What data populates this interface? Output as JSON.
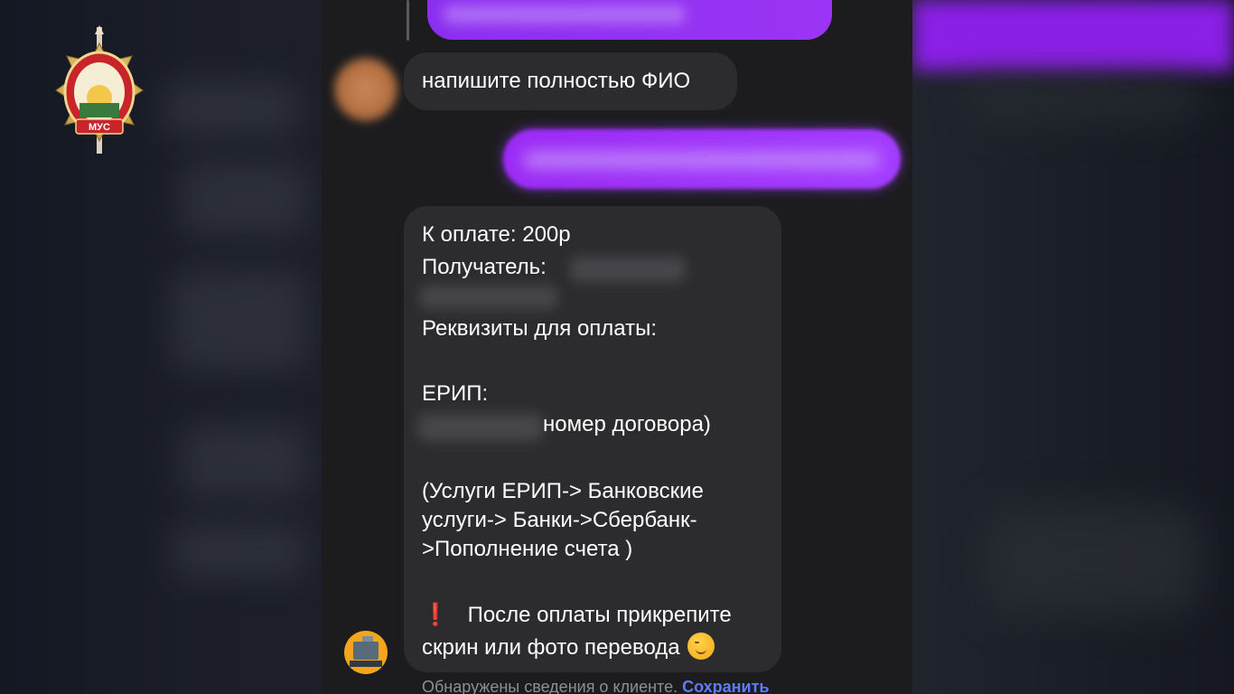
{
  "emblem": {
    "text": "МУС"
  },
  "chat": {
    "messages": [
      {
        "text": "напишите полностью ФИО"
      }
    ],
    "payment": {
      "amount_line": "К оплате: 200р",
      "recipient_label": "Получатель:",
      "requisites_label": "Реквизиты для оплаты:",
      "erip_label": "ЕРИП:",
      "contract_suffix": "номер договора)",
      "path_line1": "(Услуги ЕРИП-> Банковские",
      "path_line2": "услуги-> Банки->Сбербанк-",
      "path_line3": ">Пополнение счета )",
      "after_line1": "После оплаты прикрепите",
      "after_line2": "скрин или фото перевода",
      "exclamation": "❗",
      "emoji_name": "winking-face-emoji"
    },
    "client_note": {
      "text": "Обнаружены сведения о клиенте.",
      "action": "Сохранить"
    }
  },
  "colors": {
    "outgoing_bubble": "#9b2bf5",
    "incoming_bubble": "#2c2c2e",
    "link": "#5e7cff",
    "background": "#1c1c1e"
  }
}
